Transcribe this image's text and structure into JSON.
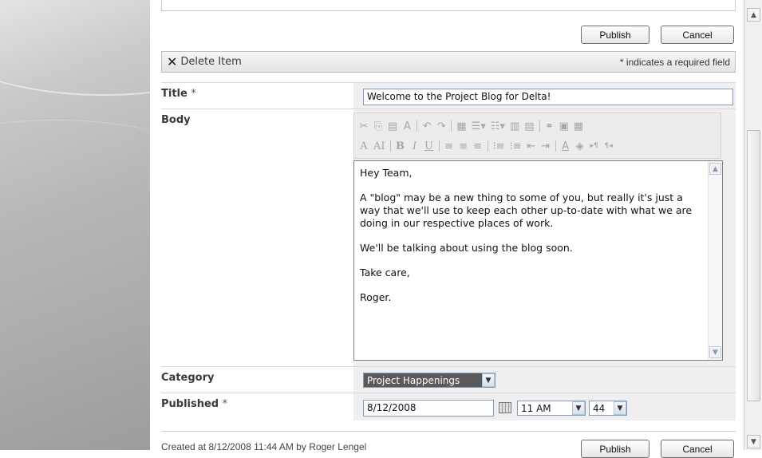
{
  "buttons": {
    "publish": "Publish",
    "cancel": "Cancel"
  },
  "toolbar": {
    "delete_label": "Delete Item",
    "required_note": "* indicates a required field"
  },
  "fields": {
    "title": {
      "label": "Title",
      "required_mark": "*",
      "value": "Welcome to the Project Blog for Delta!"
    },
    "body": {
      "label": "Body",
      "paragraphs": [
        "Hey Team,",
        "A \"blog\" may be a new  thing to some of you, but really it's just a way that we'll use to keep each other up-to-date with what we are doing in our respective places of work.",
        "We'll be talking about using the blog soon.",
        "Take care,",
        "Roger."
      ]
    },
    "category": {
      "label": "Category",
      "selected": "Project Happenings"
    },
    "published": {
      "label": "Published",
      "required_mark": "*",
      "date": "8/12/2008",
      "hour": "11 AM",
      "minute": "44"
    }
  },
  "rte_toolbar": {
    "row1": [
      "cut-icon",
      "copy-icon",
      "paste-icon",
      "format-painter-icon",
      "undo-icon",
      "redo-icon",
      "table-icon",
      "insert-row-icon",
      "insert-column-icon",
      "merge-cells-icon",
      "split-cells-icon",
      "link-icon",
      "image-icon",
      "source-icon"
    ],
    "row2": [
      "font-icon",
      "font-size-icon",
      "bold-icon",
      "italic-icon",
      "underline-icon",
      "align-left-icon",
      "align-center-icon",
      "align-right-icon",
      "numbered-list-icon",
      "bullet-list-icon",
      "outdent-icon",
      "indent-icon",
      "text-color-icon",
      "highlight-icon",
      "ltr-icon",
      "rtl-icon"
    ]
  },
  "footer": {
    "created": "Created at 8/12/2008 11:44 AM  by Roger Lengel"
  }
}
